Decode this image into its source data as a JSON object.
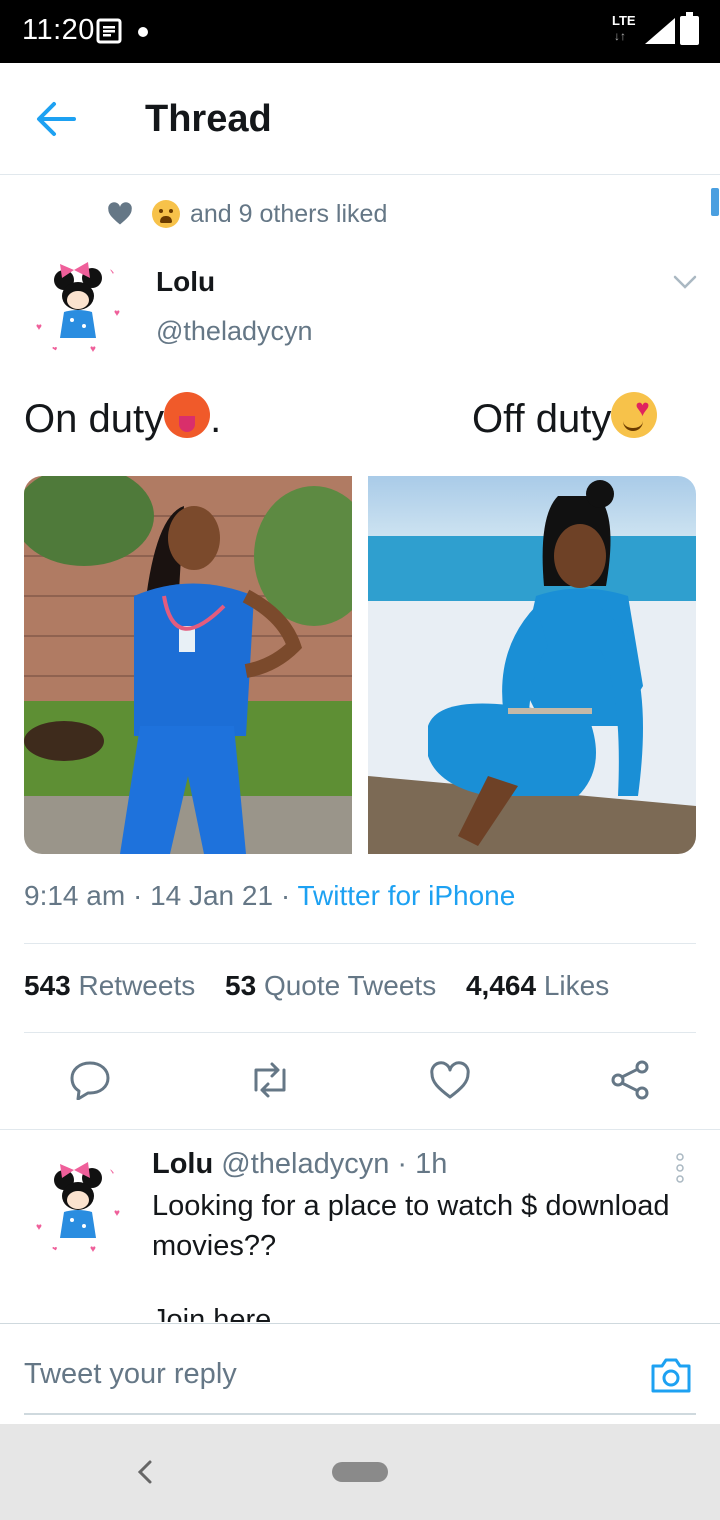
{
  "status_bar": {
    "time": "11:20",
    "network": "LTE",
    "icons": [
      "notification-icon",
      "signal-icon",
      "battery-icon"
    ]
  },
  "header": {
    "title": "Thread"
  },
  "liked_by": {
    "text": "and 9 others liked"
  },
  "tweet": {
    "name": "Lolu",
    "handle": "@theladycyn",
    "text_left": "On duty",
    "text_left_suffix": ".",
    "text_right": "Off duty",
    "time": "9:14 am",
    "date": "14 Jan 21",
    "source": "Twitter for iPhone",
    "stats": {
      "retweets_count": "543",
      "retweets_label": "Retweets",
      "quotes_count": "53",
      "quotes_label": "Quote Tweets",
      "likes_count": "4,464",
      "likes_label": "Likes"
    }
  },
  "reply": {
    "name": "Lolu",
    "handle": "@theladycyn",
    "time": "1h",
    "text": "Looking for a place to watch $ download movies??",
    "text_more": "Join here"
  },
  "composer": {
    "placeholder": "Tweet your reply"
  },
  "colors": {
    "accent": "#1da1f2",
    "secondary_text": "#657786",
    "divider": "#e1e8ed"
  }
}
